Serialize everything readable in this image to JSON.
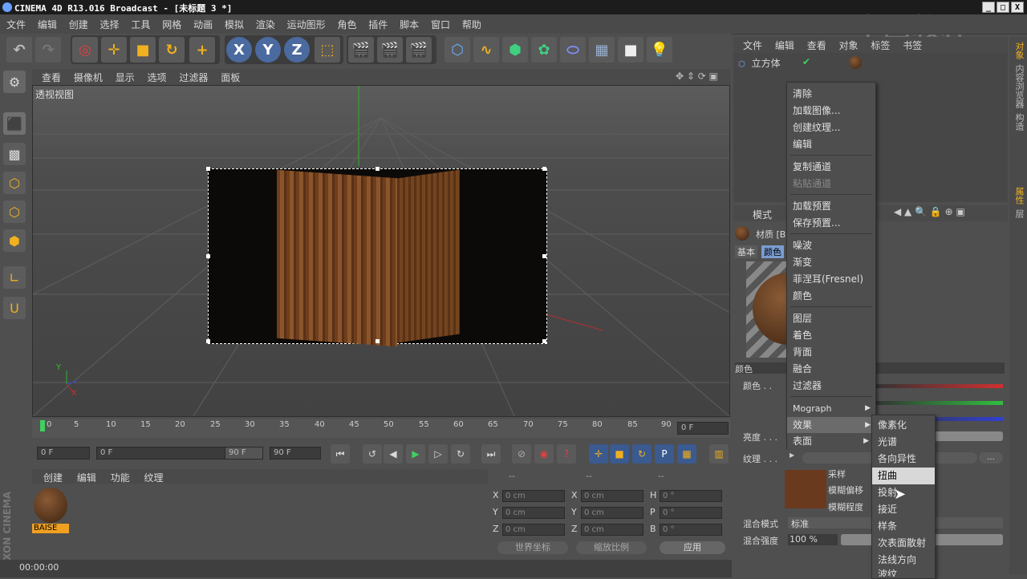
{
  "titlebar": {
    "title": "CINEMA 4D R13.016 Broadcast - [未标题 3 *]",
    "watermark": "中国教程"
  },
  "window_buttons": [
    "_",
    "□",
    "X"
  ],
  "menubar": [
    "文件",
    "编辑",
    "创建",
    "选择",
    "工具",
    "网格",
    "动画",
    "模拟",
    "渲染",
    "运动图形",
    "角色",
    "插件",
    "脚本",
    "窗口",
    "帮助"
  ],
  "toolbar": {
    "x": "X",
    "y": "Y",
    "z": "Z"
  },
  "viewport_menu": [
    "查看",
    "摄像机",
    "显示",
    "选项",
    "过滤器",
    "面板"
  ],
  "viewport": {
    "title": "透视视图",
    "axis_y": "Y",
    "axis_x": "X"
  },
  "timeline": {
    "ticks": [
      "0",
      "5",
      "10",
      "15",
      "20",
      "25",
      "30",
      "35",
      "40",
      "45",
      "50",
      "55",
      "60",
      "65",
      "70",
      "75",
      "80",
      "85",
      "90"
    ],
    "end_field": "0 F"
  },
  "playback": {
    "start": "0 F",
    "range_start": "0 F",
    "range_end": "90 F",
    "end": "90 F"
  },
  "material_menu": [
    "创建",
    "编辑",
    "功能",
    "纹理"
  ],
  "material": {
    "name": "BAISE"
  },
  "coords": {
    "headers": [
      "--",
      "--",
      "--"
    ],
    "rows": [
      {
        "a": "X",
        "av": "0 cm",
        "b": "X",
        "bv": "0 cm",
        "c": "H",
        "cv": "0 °"
      },
      {
        "a": "Y",
        "av": "0 cm",
        "b": "Y",
        "bv": "0 cm",
        "c": "P",
        "cv": "0 °"
      },
      {
        "a": "Z",
        "av": "0 cm",
        "b": "Z",
        "bv": "0 cm",
        "c": "B",
        "cv": "0 °"
      }
    ],
    "world": "世界坐标",
    "scale": "缩放比例",
    "apply": "应用"
  },
  "status": {
    "time": "00:00:00"
  },
  "object_menu": [
    "文件",
    "编辑",
    "查看",
    "对象",
    "标签",
    "书签"
  ],
  "object": {
    "name": "立方体"
  },
  "side_tabs": [
    "对象",
    "内容浏览器",
    "构造",
    "属性",
    "层"
  ],
  "attributes": {
    "mode_label": "模式",
    "material_label": "材质 [B",
    "tab_basic": "基本",
    "tab_color": "颜色",
    "section_color": "颜色",
    "color_label": "颜色 . .",
    "brightness_label": "亮度 . . .",
    "texture_label": "纹理 . . .",
    "sample_label": "采样",
    "blur_offset_label": "模糊偏移",
    "blur_level_label": "模糊程度",
    "blend_mode_label": "混合模式",
    "blend_mode_value": "标准",
    "blend_strength_label": "混合强度",
    "blend_strength_value": "100 %",
    "more_btn": "..."
  },
  "context_menu": {
    "items": [
      {
        "label": "清除"
      },
      {
        "label": "加载图像..."
      },
      {
        "label": "创建纹理..."
      },
      {
        "label": "编辑"
      },
      {
        "label": "复制通道"
      },
      {
        "label": "粘贴通道"
      },
      {
        "label": "加载预置"
      },
      {
        "label": "保存预置..."
      },
      {
        "label": "噪波"
      },
      {
        "label": "渐变"
      },
      {
        "label": "菲涅耳(Fresnel)"
      },
      {
        "label": "颜色"
      },
      {
        "label": "图层"
      },
      {
        "label": "着色"
      },
      {
        "label": "背面"
      },
      {
        "label": "融合"
      },
      {
        "label": "过滤器"
      },
      {
        "label": "Mograph"
      },
      {
        "label": "效果"
      },
      {
        "label": "表面"
      }
    ]
  },
  "submenu": {
    "items": [
      "像素化",
      "光谱",
      "各向异性",
      "扭曲",
      "投射",
      "接近",
      "样条",
      "次表面散射",
      "法线方向",
      "波纹"
    ]
  },
  "colors": {
    "accent_orange": "#f0a020",
    "timeline_green": "#40d060",
    "red": "#d03030",
    "green": "#30c040",
    "blue": "#3040d0"
  }
}
